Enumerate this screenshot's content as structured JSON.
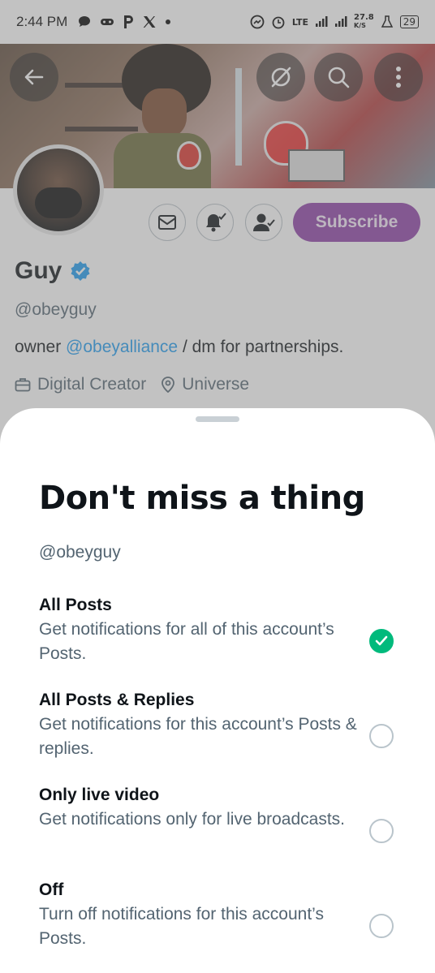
{
  "status_bar": {
    "time": "2:44 PM",
    "network": "LTE",
    "speed": "27.8",
    "speed_unit": "K/S",
    "battery": "29"
  },
  "profile": {
    "name": "Guy",
    "handle": "@obeyguy",
    "bio_prefix": "owner ",
    "bio_mention": "@obeyalliance",
    "bio_suffix": " / dm for partnerships.",
    "category": "Digital Creator",
    "location": "Universe",
    "subscribe_label": "Subscribe",
    "verified_color": "#1d9bf0",
    "subscribe_color": "#8c3fa6"
  },
  "sheet": {
    "title": "Don't miss a thing",
    "handle": "@obeyguy",
    "options": [
      {
        "title": "All Posts",
        "description": "Get notifications for all of this account’s Posts.",
        "selected": true
      },
      {
        "title": "All Posts & Replies",
        "description": "Get notifications for this account’s Posts & replies.",
        "selected": false
      },
      {
        "title": "Only live video",
        "description": "Get notifications only for live broadcasts.",
        "selected": false
      },
      {
        "title": "Off",
        "description": "Turn off notifications for this account’s Posts.",
        "selected": false
      }
    ],
    "selected_color": "#00ba7c"
  }
}
